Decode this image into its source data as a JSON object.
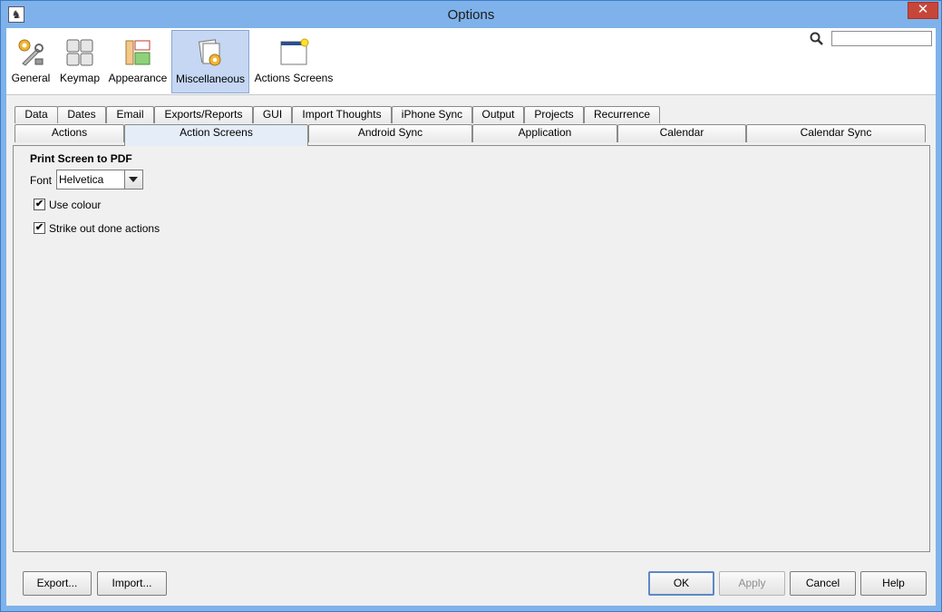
{
  "window": {
    "title": "Options"
  },
  "categories": [
    {
      "id": "general",
      "label": "General",
      "icon": "wrench-gear-icon"
    },
    {
      "id": "keymap",
      "label": "Keymap",
      "icon": "keyboard-keys-icon"
    },
    {
      "id": "appearance",
      "label": "Appearance",
      "icon": "layout-icon"
    },
    {
      "id": "misc",
      "label": "Miscellaneous",
      "icon": "papers-gear-icon"
    },
    {
      "id": "actions_screens",
      "label": "Actions Screens",
      "icon": "window-icon"
    }
  ],
  "selected_category": "Miscellaneous",
  "search": {
    "value": "",
    "placeholder": ""
  },
  "tabs_row1": [
    "Data",
    "Dates",
    "Email",
    "Exports/Reports",
    "GUI",
    "Import Thoughts",
    "iPhone Sync",
    "Output",
    "Projects",
    "Recurrence"
  ],
  "tabs_row2": [
    "Actions",
    "Action Screens",
    "Android Sync",
    "Application",
    "Calendar",
    "Calendar Sync"
  ],
  "selected_tab": "Action Screens",
  "panel": {
    "section_title": "Print Screen to PDF",
    "font_label": "Font",
    "font_value": "Helvetica",
    "use_colour": {
      "label": "Use colour",
      "checked": true
    },
    "strike_out": {
      "label": "Strike out done actions",
      "checked": true
    }
  },
  "buttons": {
    "export": "Export...",
    "import": "Import...",
    "ok": "OK",
    "apply": "Apply",
    "cancel": "Cancel",
    "help": "Help"
  },
  "colors": {
    "titlebar": "#7fb2ea",
    "selection": "#c5d7f2",
    "close": "#c7463a"
  }
}
